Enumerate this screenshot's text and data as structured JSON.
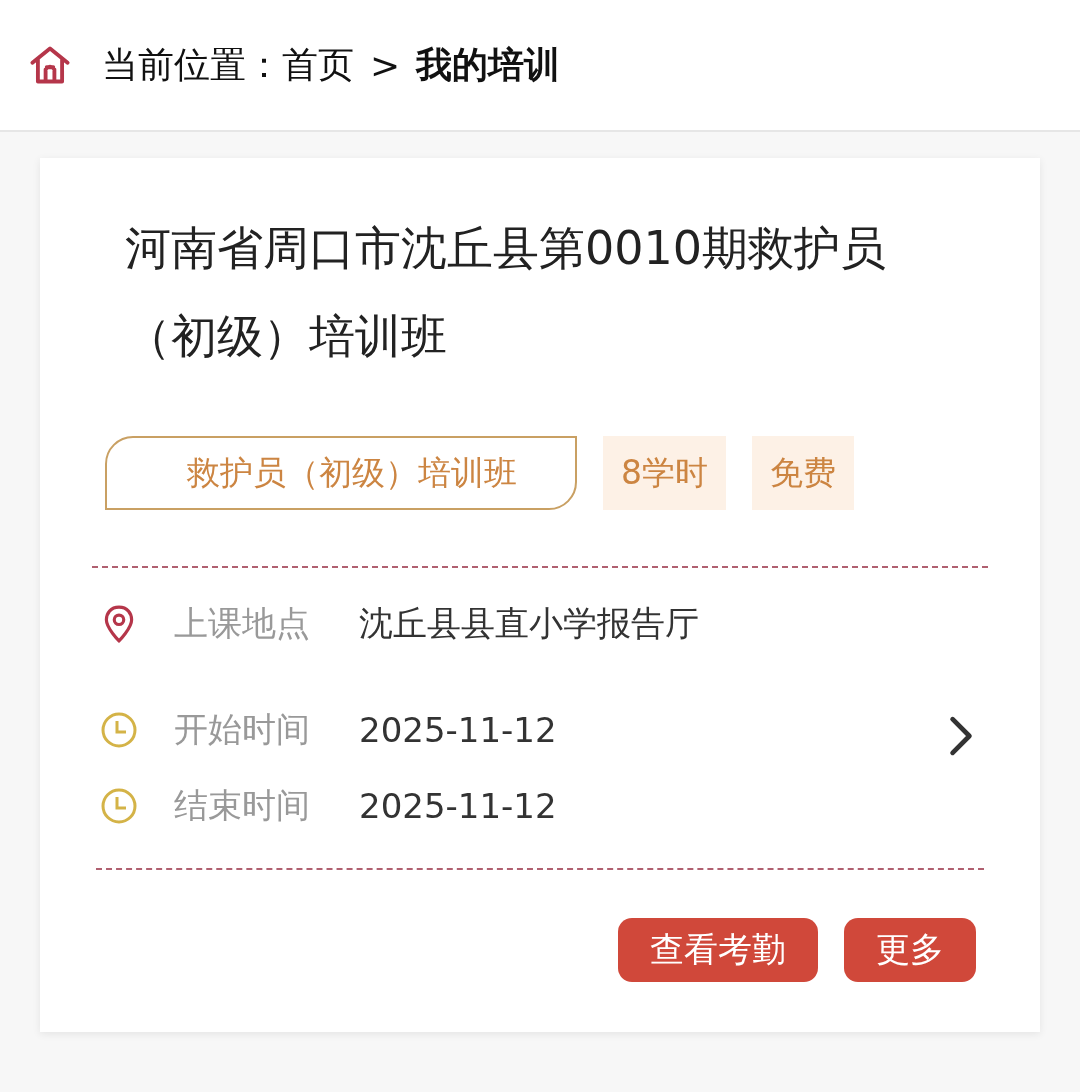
{
  "breadcrumb": {
    "label": "当前位置：",
    "items": [
      {
        "text": "首页",
        "selected": false
      },
      {
        "text": "我的培训",
        "selected": true
      }
    ],
    "separator": ">"
  },
  "card": {
    "title": "河南省周口市沈丘县第0010期救护员（初级）培训班",
    "tags": [
      {
        "kind": "outline",
        "text": "救护员（初级）培训班"
      },
      {
        "kind": "soft",
        "text": "8学时"
      },
      {
        "kind": "soft",
        "text": "免费"
      }
    ],
    "info": [
      {
        "kind": "location",
        "label": "上课地点",
        "value": "沈丘县县直小学报告厅"
      },
      {
        "kind": "time",
        "label": "开始时间",
        "value": "2025-11-12"
      },
      {
        "kind": "time",
        "label": "结束时间",
        "value": "2025-11-12"
      }
    ],
    "buttons": [
      "查看考勤",
      "更多"
    ]
  }
}
